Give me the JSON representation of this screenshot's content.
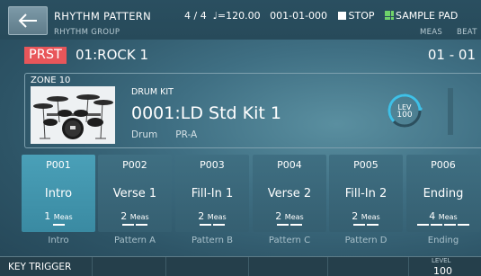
{
  "header": {
    "title": "RHYTHM PATTERN",
    "time_signature": "4 / 4",
    "tempo": "♩=120.00",
    "position": "001-01-000",
    "stop_label": "STOP",
    "sample_pad_label": "SAMPLE PAD"
  },
  "rhythm_group": {
    "label": "RHYTHM GROUP",
    "tag": "PRST",
    "name": "01:ROCK 1",
    "meas_label": "MEAS",
    "beat_label": "BEAT",
    "meas_beat_value": "01 - 01"
  },
  "zone": {
    "label": "ZONE 10",
    "kit_label": "DRUM KIT",
    "kit_name": "0001:LD Std Kit 1",
    "category": "Drum",
    "bank": "PR-A",
    "level_label": "LEV",
    "level_value": "100"
  },
  "patterns": [
    {
      "id": "P001",
      "name": "Intro",
      "meas": "1",
      "bars": 1,
      "sub": "Intro"
    },
    {
      "id": "P002",
      "name": "Verse 1",
      "meas": "2",
      "bars": 2,
      "sub": "Pattern A"
    },
    {
      "id": "P003",
      "name": "Fill-In 1",
      "meas": "2",
      "bars": 2,
      "sub": "Pattern B"
    },
    {
      "id": "P004",
      "name": "Verse 2",
      "meas": "2",
      "bars": 2,
      "sub": "Pattern C"
    },
    {
      "id": "P005",
      "name": "Fill-In 2",
      "meas": "2",
      "bars": 2,
      "sub": "Pattern D"
    },
    {
      "id": "P006",
      "name": "Ending",
      "meas": "4",
      "bars": 4,
      "sub": "Ending"
    }
  ],
  "meas_unit": "Meas",
  "selected_pattern": "P001",
  "footer": {
    "key_trigger": "KEY TRIGGER",
    "level_label": "LEVEL",
    "level_value": "100"
  },
  "colors": {
    "prst_tag": "#e8565a",
    "selected_pad": "#4aa0b8",
    "level_ring": "#3fc1e8",
    "sample_pad_icon": "#6fd26a"
  }
}
